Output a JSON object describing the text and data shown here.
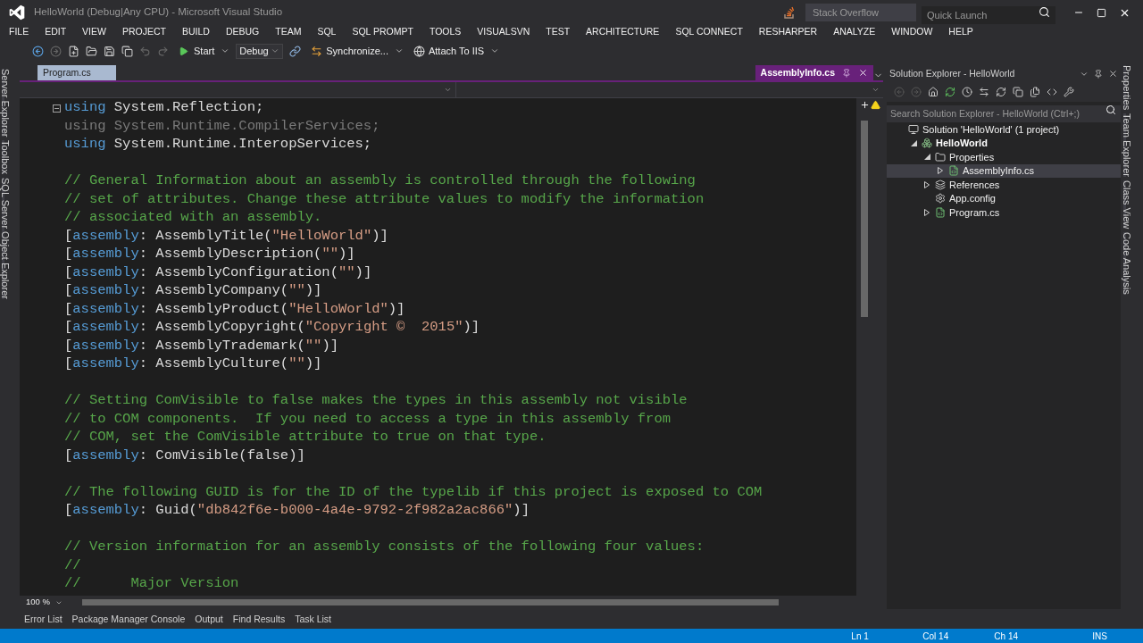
{
  "window": {
    "title": "HelloWorld (Debug|Any CPU) - Microsoft Visual Studio",
    "search_provider": {
      "placeholder": "Stack Overflow"
    },
    "quick_launch": {
      "placeholder": "Quick Launch"
    }
  },
  "menu": [
    "FILE",
    "EDIT",
    "VIEW",
    "PROJECT",
    "BUILD",
    "DEBUG",
    "TEAM",
    "SQL",
    "SQL PROMPT",
    "TOOLS",
    "VISUALSVN",
    "TEST",
    "ARCHITECTURE",
    "SQL CONNECT",
    "RESHARPER",
    "ANALYZE",
    "WINDOW",
    "HELP"
  ],
  "toolbar": {
    "start": "Start",
    "configuration": "Debug",
    "synchronize": "Synchronize...",
    "attach": "Attach To IIS"
  },
  "left_tool_tabs": [
    "Server Explorer",
    "Toolbox",
    "SQL Server Object Explorer"
  ],
  "right_tool_tabs": [
    "Properties",
    "Team Explorer",
    "Class View",
    "Code Analysis"
  ],
  "editor_tabs": [
    {
      "label": "Program.cs",
      "kind": "normal",
      "selected": false
    },
    {
      "label": "AssemblyInfo.cs",
      "kind": "preview",
      "selected": true
    }
  ],
  "code_blocks": [
    [
      [
        {
          "kind": "keyword",
          "text": "using"
        },
        {
          "kind": "plain",
          "text": " System.Reflection;"
        }
      ],
      [
        {
          "kind": "unused",
          "text": "using System.Runtime.CompilerServices;"
        }
      ],
      [
        {
          "kind": "keyword",
          "text": "using"
        },
        {
          "kind": "plain",
          "text": " System.Runtime.InteropServices;"
        }
      ]
    ],
    [
      [
        {
          "kind": "comment",
          "text": "// General Information about an assembly is controlled through the following"
        }
      ],
      [
        {
          "kind": "comment",
          "text": "// set of attributes. Change these attribute values to modify the information"
        }
      ],
      [
        {
          "kind": "comment",
          "text": "// associated with an assembly."
        }
      ],
      [
        {
          "kind": "plain",
          "text": "["
        },
        {
          "kind": "keyword",
          "text": "assembly"
        },
        {
          "kind": "plain",
          "text": ": AssemblyTitle("
        },
        {
          "kind": "string",
          "text": "\"HelloWorld\""
        },
        {
          "kind": "plain",
          "text": ")]"
        }
      ],
      [
        {
          "kind": "plain",
          "text": "["
        },
        {
          "kind": "keyword",
          "text": "assembly"
        },
        {
          "kind": "plain",
          "text": ": AssemblyDescription("
        },
        {
          "kind": "string",
          "text": "\"\""
        },
        {
          "kind": "plain",
          "text": ")]"
        }
      ],
      [
        {
          "kind": "plain",
          "text": "["
        },
        {
          "kind": "keyword",
          "text": "assembly"
        },
        {
          "kind": "plain",
          "text": ": AssemblyConfiguration("
        },
        {
          "kind": "string",
          "text": "\"\""
        },
        {
          "kind": "plain",
          "text": ")]"
        }
      ],
      [
        {
          "kind": "plain",
          "text": "["
        },
        {
          "kind": "keyword",
          "text": "assembly"
        },
        {
          "kind": "plain",
          "text": ": AssemblyCompany("
        },
        {
          "kind": "string",
          "text": "\"\""
        },
        {
          "kind": "plain",
          "text": ")]"
        }
      ],
      [
        {
          "kind": "plain",
          "text": "["
        },
        {
          "kind": "keyword",
          "text": "assembly"
        },
        {
          "kind": "plain",
          "text": ": AssemblyProduct("
        },
        {
          "kind": "string",
          "text": "\"HelloWorld\""
        },
        {
          "kind": "plain",
          "text": ")]"
        }
      ],
      [
        {
          "kind": "plain",
          "text": "["
        },
        {
          "kind": "keyword",
          "text": "assembly"
        },
        {
          "kind": "plain",
          "text": ": AssemblyCopyright("
        },
        {
          "kind": "string",
          "text": "\"Copyright ©  2015\""
        },
        {
          "kind": "plain",
          "text": ")]"
        }
      ],
      [
        {
          "kind": "plain",
          "text": "["
        },
        {
          "kind": "keyword",
          "text": "assembly"
        },
        {
          "kind": "plain",
          "text": ": AssemblyTrademark("
        },
        {
          "kind": "string",
          "text": "\"\""
        },
        {
          "kind": "plain",
          "text": ")]"
        }
      ],
      [
        {
          "kind": "plain",
          "text": "["
        },
        {
          "kind": "keyword",
          "text": "assembly"
        },
        {
          "kind": "plain",
          "text": ": AssemblyCulture("
        },
        {
          "kind": "string",
          "text": "\"\""
        },
        {
          "kind": "plain",
          "text": ")]"
        }
      ]
    ],
    [
      [
        {
          "kind": "comment",
          "text": "// Setting ComVisible to false makes the types in this assembly not visible"
        }
      ],
      [
        {
          "kind": "comment",
          "text": "// to COM components.  If you need to access a type in this assembly from"
        }
      ],
      [
        {
          "kind": "comment",
          "text": "// COM, set the ComVisible attribute to true on that type."
        }
      ],
      [
        {
          "kind": "plain",
          "text": "["
        },
        {
          "kind": "keyword",
          "text": "assembly"
        },
        {
          "kind": "plain",
          "text": ": ComVisible(false)]"
        }
      ]
    ],
    [
      [
        {
          "kind": "comment",
          "text": "// The following GUID is for the ID of the typelib if this project is exposed to COM"
        }
      ],
      [
        {
          "kind": "plain",
          "text": "["
        },
        {
          "kind": "keyword",
          "text": "assembly"
        },
        {
          "kind": "plain",
          "text": ": Guid("
        },
        {
          "kind": "string",
          "text": "\"db842f6e-b000-4a4e-9792-2f982a2ac866\""
        },
        {
          "kind": "plain",
          "text": ")]"
        }
      ]
    ],
    [
      [
        {
          "kind": "comment",
          "text": "// Version information for an assembly consists of the following four values:"
        }
      ],
      [
        {
          "kind": "comment",
          "text": "//"
        }
      ],
      [
        {
          "kind": "comment",
          "text": "//      Major Version"
        }
      ]
    ]
  ],
  "zoom": "100 %",
  "solution_explorer": {
    "title": "Solution Explorer - HelloWorld",
    "search": {
      "placeholder": "Search Solution Explorer - HelloWorld (Ctrl+;)"
    },
    "tree": [
      {
        "label": "Solution 'HelloWorld' (1 project)",
        "kind": "solution",
        "expandable": false,
        "selected": false,
        "children": [
          {
            "label": "HelloWorld",
            "kind": "project",
            "expandable": true,
            "expanded": true,
            "selected": false,
            "children": [
              {
                "label": "Properties",
                "kind": "folder",
                "expandable": true,
                "expanded": true,
                "selected": false,
                "children": [
                  {
                    "label": "AssemblyInfo.cs",
                    "kind": "csharp",
                    "expandable": true,
                    "expanded": false,
                    "selected": true
                  }
                ]
              },
              {
                "label": "References",
                "kind": "references",
                "expandable": true,
                "expanded": false,
                "selected": false
              },
              {
                "label": "App.config",
                "kind": "config",
                "expandable": false,
                "selected": false
              },
              {
                "label": "Program.cs",
                "kind": "csharp",
                "expandable": true,
                "expanded": false,
                "selected": false
              }
            ]
          }
        ]
      }
    ]
  },
  "bottom_tabs": [
    "Error List",
    "Package Manager Console",
    "Output",
    "Find Results",
    "Task List"
  ],
  "status_bar": {
    "line": "Ln 1",
    "column": "Col 14",
    "char": "Ch 14",
    "mode": "INS"
  }
}
